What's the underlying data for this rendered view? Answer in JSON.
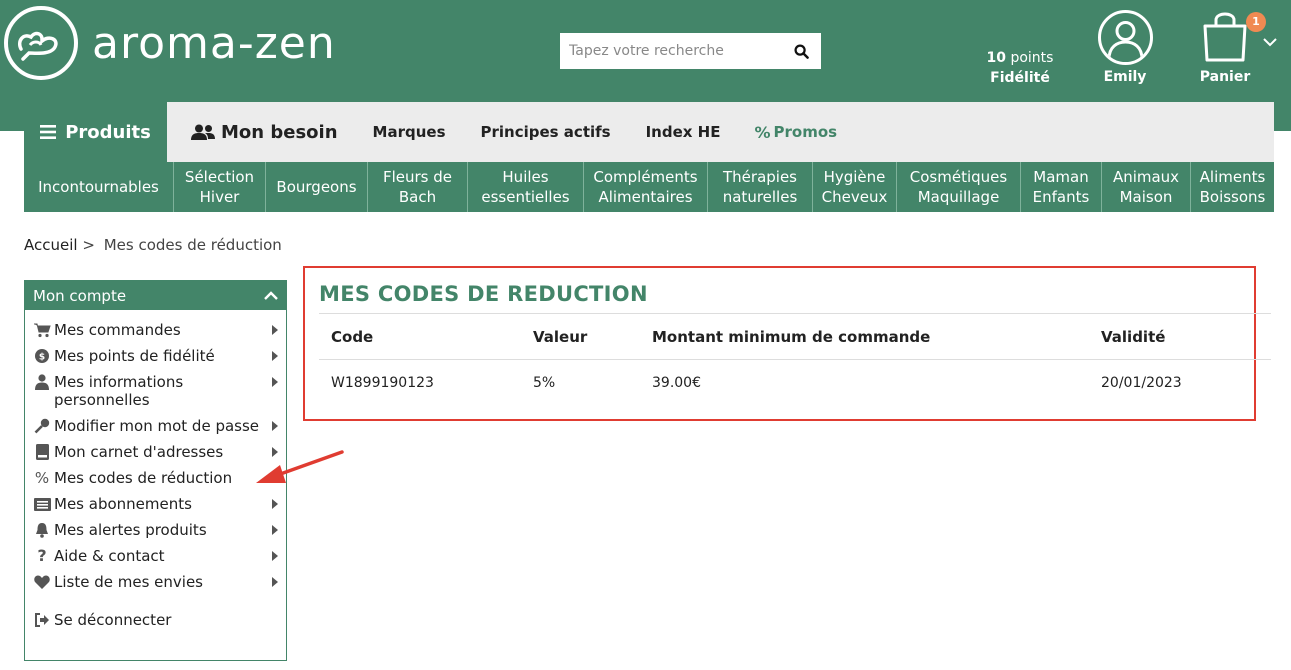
{
  "header": {
    "brand": "aroma-zen",
    "search": {
      "placeholder": "Tapez votre recherche"
    },
    "loyalty": {
      "points_number": "10",
      "points_word": "points",
      "label": "Fidélité"
    },
    "account": {
      "label": "Emily"
    },
    "cart": {
      "label": "Panier",
      "count": "1"
    }
  },
  "nav": {
    "products": "Produits",
    "besoin": "Mon besoin",
    "items": [
      "Marques",
      "Principes actifs",
      "Index HE"
    ],
    "promos": "Promos"
  },
  "categories": [
    {
      "l1": "Incontournables",
      "l2": ""
    },
    {
      "l1": "Sélection",
      "l2": "Hiver"
    },
    {
      "l1": "Bourgeons",
      "l2": ""
    },
    {
      "l1": "Fleurs de",
      "l2": "Bach"
    },
    {
      "l1": "Huiles",
      "l2": "essentielles"
    },
    {
      "l1": "Compléments",
      "l2": "Alimentaires"
    },
    {
      "l1": "Thérapies",
      "l2": "naturelles"
    },
    {
      "l1": "Hygiène",
      "l2": "Cheveux"
    },
    {
      "l1": "Cosmétiques",
      "l2": "Maquillage"
    },
    {
      "l1": "Maman",
      "l2": "Enfants"
    },
    {
      "l1": "Animaux",
      "l2": "Maison"
    },
    {
      "l1": "Aliments",
      "l2": "Boissons"
    }
  ],
  "breadcrumb": {
    "home": "Accueil",
    "separator": ">",
    "current": "Mes codes de réduction"
  },
  "sidebar": {
    "title": "Mon compte",
    "items": [
      {
        "label": "Mes commandes",
        "icon": "cart-icon"
      },
      {
        "label": "Mes points de fidélité",
        "icon": "loyalty-icon"
      },
      {
        "label": "Mes informations personnelles",
        "icon": "user-icon"
      },
      {
        "label": "Modifier mon mot de passe",
        "icon": "key-icon"
      },
      {
        "label": "Mon carnet d'adresses",
        "icon": "address-book-icon"
      },
      {
        "label": "Mes codes de réduction",
        "icon": "percent-icon"
      },
      {
        "label": "Mes abonnements",
        "icon": "subscription-icon"
      },
      {
        "label": "Mes alertes produits",
        "icon": "bell-icon"
      },
      {
        "label": "Aide & contact",
        "icon": "question-icon"
      },
      {
        "label": "Liste de mes envies",
        "icon": "heart-icon"
      }
    ],
    "logout": "Se déconnecter"
  },
  "codes": {
    "title": "MES CODES DE REDUCTION",
    "columns": [
      "Code",
      "Valeur",
      "Montant minimum de commande",
      "Validité"
    ],
    "rows": [
      [
        "W1899190123",
        "5%",
        "39.00€",
        "20/01/2023"
      ]
    ]
  },
  "colors": {
    "brand_green": "#438569",
    "accent_red": "#e03c31",
    "badge_orange": "#f08a52"
  }
}
